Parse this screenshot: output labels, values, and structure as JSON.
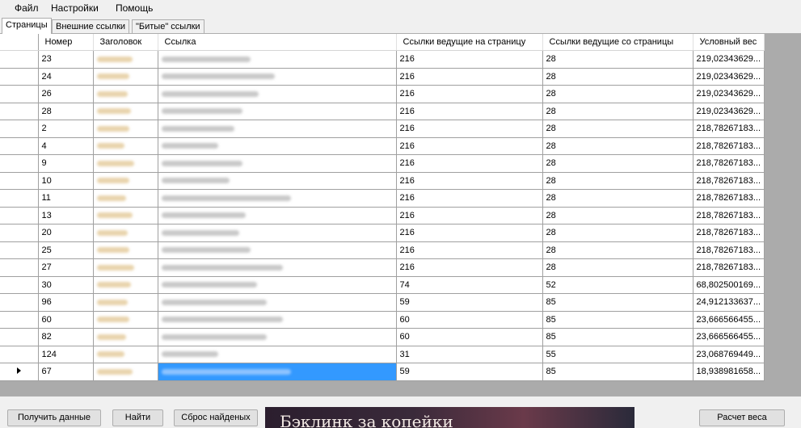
{
  "menu": {
    "file": "Файл",
    "settings": "Настройки",
    "help": "Помощь"
  },
  "tabs": [
    "Страницы",
    "Внешние ссылки",
    "\"Битые\" ссылки"
  ],
  "columns": {
    "num": "Номер",
    "title": "Заголовок",
    "link": "Ссылка",
    "in_links": "Ссылки ведущие на страницу",
    "out_links": "Ссылки ведущие со страницы",
    "weight": "Условный вес"
  },
  "rows": [
    {
      "num": "23",
      "in": "216",
      "out": "28",
      "weight": "219,02343629..."
    },
    {
      "num": "24",
      "in": "216",
      "out": "28",
      "weight": "219,02343629..."
    },
    {
      "num": "26",
      "in": "216",
      "out": "28",
      "weight": "219,02343629..."
    },
    {
      "num": "28",
      "in": "216",
      "out": "28",
      "weight": "219,02343629..."
    },
    {
      "num": "2",
      "in": "216",
      "out": "28",
      "weight": "218,78267183..."
    },
    {
      "num": "4",
      "in": "216",
      "out": "28",
      "weight": "218,78267183..."
    },
    {
      "num": "9",
      "in": "216",
      "out": "28",
      "weight": "218,78267183..."
    },
    {
      "num": "10",
      "in": "216",
      "out": "28",
      "weight": "218,78267183..."
    },
    {
      "num": "11",
      "in": "216",
      "out": "28",
      "weight": "218,78267183..."
    },
    {
      "num": "13",
      "in": "216",
      "out": "28",
      "weight": "218,78267183..."
    },
    {
      "num": "20",
      "in": "216",
      "out": "28",
      "weight": "218,78267183..."
    },
    {
      "num": "25",
      "in": "216",
      "out": "28",
      "weight": "218,78267183..."
    },
    {
      "num": "27",
      "in": "216",
      "out": "28",
      "weight": "218,78267183..."
    },
    {
      "num": "30",
      "in": "74",
      "out": "52",
      "weight": "68,802500169..."
    },
    {
      "num": "96",
      "in": "59",
      "out": "85",
      "weight": "24,912133637..."
    },
    {
      "num": "60",
      "in": "60",
      "out": "85",
      "weight": "23,666566455..."
    },
    {
      "num": "82",
      "in": "60",
      "out": "85",
      "weight": "23,666566455..."
    },
    {
      "num": "124",
      "in": "31",
      "out": "55",
      "weight": "23,068769449..."
    },
    {
      "num": "67",
      "in": "59",
      "out": "85",
      "weight": "18,938981658..."
    }
  ],
  "selected_row_index": 18,
  "buttons": {
    "get_data": "Получить данные",
    "find": "Найти",
    "reset": "Сброс найденых",
    "calc": "Расчет веса"
  },
  "banner_text": "Бэклинк за копейки",
  "colors": {
    "selection": "#3399ff",
    "grid_bg": "#ababab"
  }
}
